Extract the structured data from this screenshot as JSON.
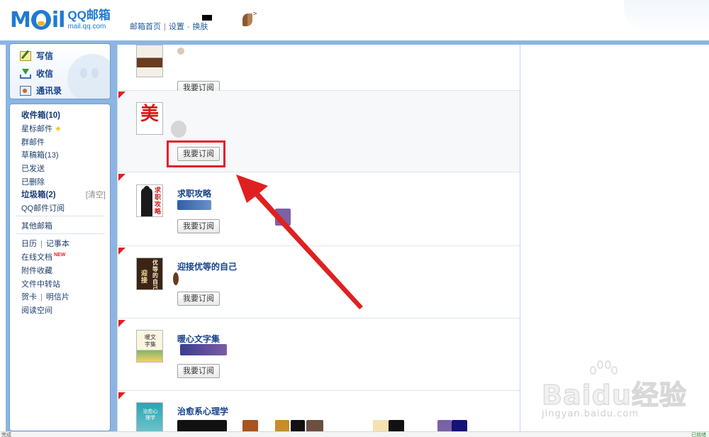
{
  "header": {
    "logo_mail": "M",
    "logo_mail_tail": "il",
    "logo_qq": "QQ邮箱",
    "logo_url": "mail.qq.com",
    "link_home": "邮箱首页",
    "link_settings": "设置",
    "link_switch": "换肤",
    "separator": "|",
    "dash": "-",
    "avatar_arrow": ">"
  },
  "sidebar": {
    "actions": [
      {
        "label": "写信",
        "icon": "write-icon"
      },
      {
        "label": "收信",
        "icon": "inbox-download-icon"
      },
      {
        "label": "通讯录",
        "icon": "contacts-icon"
      }
    ],
    "folders": {
      "inbox": "收件箱(10)",
      "starred": "星标邮件",
      "group": "群邮件",
      "drafts": "草稿箱(13)",
      "sent": "已发送",
      "deleted": "已删除",
      "spam": "垃圾箱(2)",
      "spam_clear": "[清空]",
      "subscriptions": "QQ邮件订阅",
      "other": "其他邮箱",
      "calendar": "日历",
      "notes": "记事本",
      "online_docs": "在线文档",
      "new_badge": "NEW",
      "attachments": "附件收藏",
      "file_transfer": "文件中转站",
      "cards": "贺卡",
      "postcards": "明信片",
      "reading": "阅读空间"
    }
  },
  "content": {
    "subscribe_label": "我要订阅",
    "cards": [
      {
        "title": "",
        "cover": "cover-food"
      },
      {
        "title": "",
        "cover": "cover-mei"
      },
      {
        "title": "求职攻略",
        "cover": "cover-job"
      },
      {
        "title": "迎接优等的自己",
        "cover": "cover-better-self"
      },
      {
        "title": "暖心文字集",
        "cover": "cover-warm-words"
      },
      {
        "title": "治愈系心理学",
        "cover": "cover-healing"
      }
    ],
    "cover_text": {
      "mei": "美",
      "job": "求职攻略",
      "better_self_a": "优等的自己",
      "better_self_b": "迎接",
      "warm_words": "暖文字集",
      "healing": "治愈心理学"
    }
  },
  "watermark": {
    "brand": "Baidu",
    "brand_cn": "经验",
    "url": "jingyan.baidu.com"
  },
  "colors": {
    "accent_blue": "#1f7ad2",
    "frame_blue": "#8cb5e3",
    "highlight_red": "#e3202e",
    "link_navy": "#15428b"
  },
  "status": {
    "left": "完成",
    "right": "已就绪"
  }
}
